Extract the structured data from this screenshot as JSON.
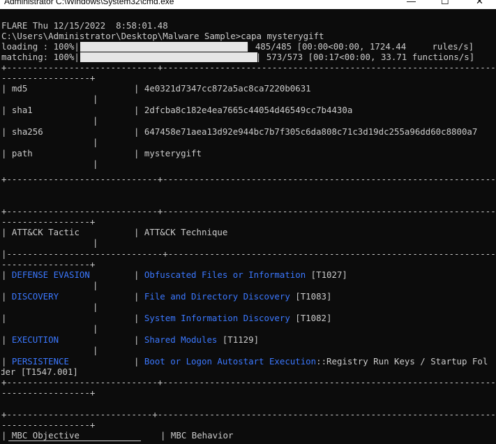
{
  "window": {
    "title": "Administrator C:\\Windows\\System32\\cmd.exe",
    "minimize_glyph": "—",
    "maximize_glyph": "☐",
    "close_glyph": "✕"
  },
  "console": {
    "banner": "FLARE Thu 12/15/2022  8:58:01.48",
    "prompt": "C:\\Users\\Administrator\\Desktop\\Malware Sample>",
    "command": "capa mysterygift",
    "loading": {
      "label": "loading : 100%|",
      "suffix": "| 485/485 [00:00<00:00, 1724.44     rules/s]",
      "progress": 1.0
    },
    "matching": {
      "label": "matching: 100%|",
      "suffix": "| 573/573 [00:17<00:00, 33.71 functions/s]",
      "progress": 1.0
    }
  },
  "file_info": {
    "rows": [
      {
        "key": "md5",
        "value": "4e0321d7347cc872a5ac8ca7220b0631"
      },
      {
        "key": "sha1",
        "value": "2dfcba8c182e4ea7665c44054d46549cc7b4430a"
      },
      {
        "key": "sha256",
        "value": "647458e71aea13d92e944bc7b7f305c6da808c71c3d19dc255a96dd60c8800a7"
      },
      {
        "key": "path",
        "value": "mysterygift"
      }
    ]
  },
  "attack_table": {
    "headers": {
      "tactic": "ATT&CK Tactic",
      "technique": "ATT&CK Technique"
    },
    "rows": [
      {
        "tactic": "DEFENSE EVASION",
        "technique": "Obfuscated Files or Information",
        "id": " [T1027]"
      },
      {
        "tactic": "DISCOVERY",
        "technique": "File and Directory Discovery",
        "id": " [T1083]"
      },
      {
        "tactic": "",
        "technique": "System Information Discovery",
        "id": " [T1082]"
      },
      {
        "tactic": "EXECUTION",
        "technique": "Shared Modules",
        "id": " [T1129]"
      },
      {
        "tactic": "PERSISTENCE",
        "technique": "Boot or Logon Autostart Execution",
        "id": "::Registry Run Keys / Startup Fol"
      }
    ],
    "wrap": "der [T1547.001]"
  },
  "mbc_table": {
    "headers": {
      "objective": "MBC Objective",
      "behavior": "MBC Behavior"
    }
  },
  "borders": {
    "full": "+-----------------------------+------------------------------------------------------------------------------------",
    "short": "-----------------+",
    "cross": "|------------------------------+-----------------------------------------------------------------------------------",
    "mbc_top": "+----------------------------+-----------------------------------------------------------------------------------",
    "pipe": "|"
  }
}
